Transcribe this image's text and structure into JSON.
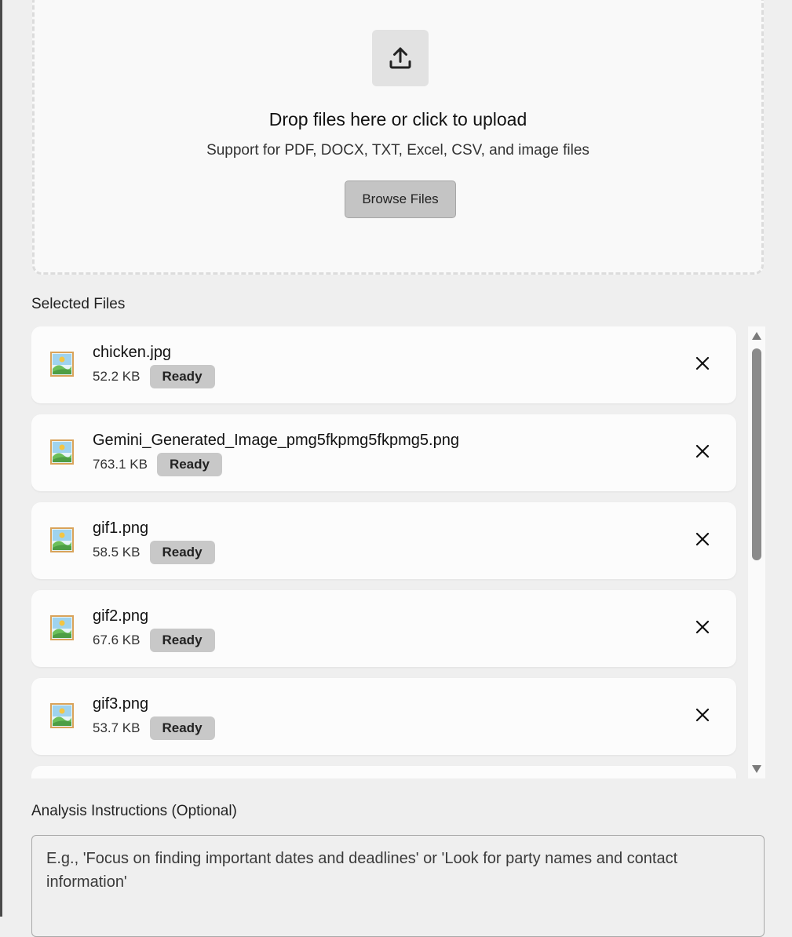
{
  "dropzone": {
    "icon": "upload-icon",
    "title": "Drop files here or click to upload",
    "subtitle": "Support for PDF, DOCX, TXT, Excel, CSV, and image files",
    "browse_label": "Browse Files"
  },
  "selected_files": {
    "label": "Selected Files",
    "files": [
      {
        "name": "chicken.jpg",
        "size": "52.2 KB",
        "status": "Ready",
        "icon": "image-icon"
      },
      {
        "name": "Gemini_Generated_Image_pmg5fkpmg5fkpmg5.png",
        "size": "763.1 KB",
        "status": "Ready",
        "icon": "image-icon"
      },
      {
        "name": "gif1.png",
        "size": "58.5 KB",
        "status": "Ready",
        "icon": "image-icon"
      },
      {
        "name": "gif2.png",
        "size": "67.6 KB",
        "status": "Ready",
        "icon": "image-icon"
      },
      {
        "name": "gif3.png",
        "size": "53.7 KB",
        "status": "Ready",
        "icon": "image-icon"
      }
    ]
  },
  "instructions": {
    "label": "Analysis Instructions (Optional)",
    "value": "",
    "placeholder": "E.g., 'Focus on finding important dates and deadlines' or 'Look for party names and contact information'"
  },
  "colors": {
    "background": "#efefef",
    "card": "#fcfcfc",
    "badge": "#c8c8c8",
    "button": "#c4c4c4",
    "scroll_thumb": "#8b8b8b"
  }
}
